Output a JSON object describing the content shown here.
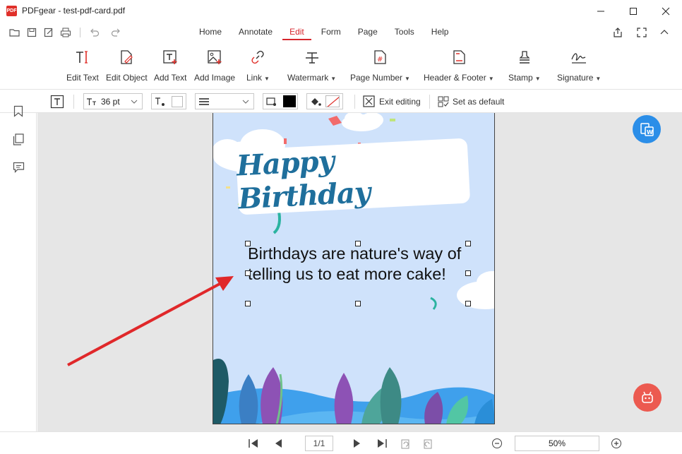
{
  "window": {
    "app_logo_text": "PDF",
    "title": "PDFgear - test-pdf-card.pdf"
  },
  "menu": {
    "tabs": [
      {
        "label": "Home"
      },
      {
        "label": "Annotate"
      },
      {
        "label": "Edit"
      },
      {
        "label": "Form"
      },
      {
        "label": "Page"
      },
      {
        "label": "Tools"
      },
      {
        "label": "Help"
      }
    ],
    "active_tab": "Edit"
  },
  "ribbon": {
    "edit_text": "Edit Text",
    "edit_object": "Edit Object",
    "add_text": "Add Text",
    "add_image": "Add Image",
    "link": "Link",
    "watermark": "Watermark",
    "page_number": "Page Number",
    "header_footer": "Header & Footer",
    "stamp": "Stamp",
    "signature": "Signature"
  },
  "format": {
    "font_size": "36 pt",
    "text_color": "#000000",
    "exit_editing": "Exit editing",
    "set_default": "Set as default"
  },
  "document": {
    "banner_text": "Happy Birthday",
    "body_line1": "Birthdays are nature's way of",
    "body_line2": "telling us to eat more cake!"
  },
  "status": {
    "page_indicator": "1/1",
    "zoom": "50%"
  },
  "colors": {
    "accent": "#d7262d",
    "page_bg": "#cfe2fb",
    "banner_text": "#1f6f9c",
    "fab_blue": "#2b8ee8",
    "fab_red": "#ec5a50",
    "arrow_red": "#e0282a"
  }
}
